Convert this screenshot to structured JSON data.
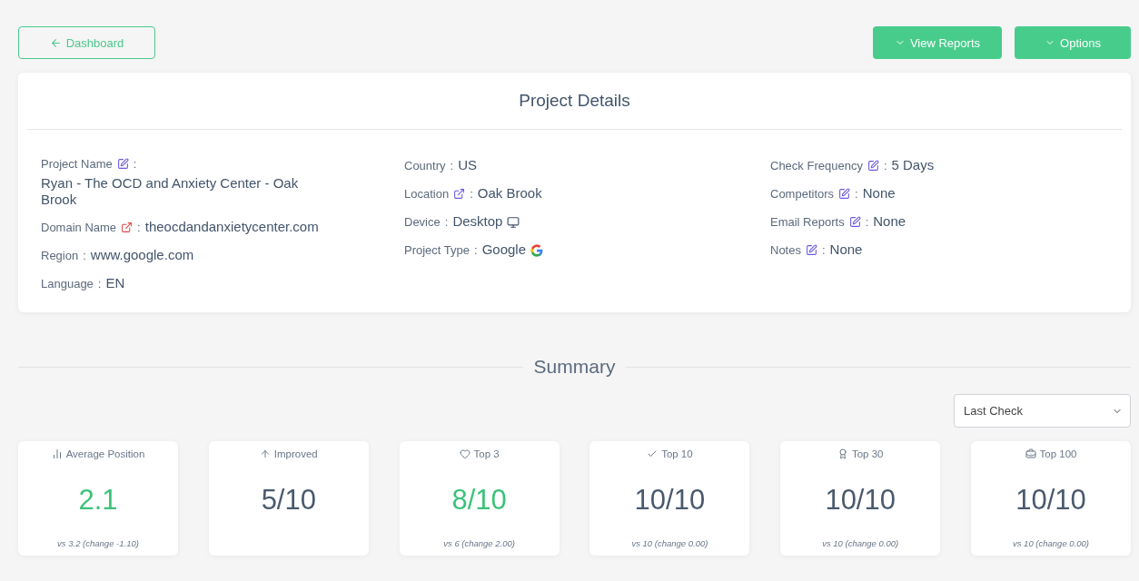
{
  "header": {
    "back_button": "Dashboard",
    "menu_buttons": [
      "View Reports",
      "Options"
    ]
  },
  "project_details": {
    "title": "Project Details",
    "columns": [
      [
        {
          "kind": "stacked_edit",
          "label": "Project Name",
          "colon": ":",
          "value": "Ryan - The OCD and Anxiety Center - Oak Brook"
        },
        {
          "kind": "link_alert",
          "label": "Domain Name",
          "colon": ":",
          "value": "theocdandanxietycenter.com"
        },
        {
          "kind": "plain",
          "label": "Region",
          "colon": ":",
          "value": "www.google.com"
        },
        {
          "kind": "plain",
          "label": "Language",
          "colon": ":",
          "value": "EN"
        }
      ],
      [
        {
          "kind": "plain",
          "label": "Country",
          "colon": ":",
          "value": "US"
        },
        {
          "kind": "link",
          "label": "Location",
          "colon": ":",
          "value": "Oak Brook"
        },
        {
          "kind": "device",
          "label": "Device",
          "colon": ":",
          "value": "Desktop"
        },
        {
          "kind": "search_engine",
          "label": "Project Type",
          "colon": ":",
          "value": "Google"
        }
      ],
      [
        {
          "kind": "edit",
          "label": "Check Frequency",
          "colon": ":",
          "value": "5 Days"
        },
        {
          "kind": "edit",
          "label": "Competitors",
          "colon": ":",
          "value": "None"
        },
        {
          "kind": "edit",
          "label": "Email Reports",
          "colon": ":",
          "value": "None"
        },
        {
          "kind": "edit",
          "label": "Notes",
          "colon": ":",
          "value": "None"
        }
      ]
    ]
  },
  "summary": {
    "title": "Summary",
    "period_select": "Last Check",
    "cards": [
      {
        "label": "Average Position",
        "value": "2.1",
        "highlighted": true,
        "comparison": "vs 3.2 (change -1.10)"
      },
      {
        "label": "Improved",
        "value": "5/10",
        "highlighted": false
      },
      {
        "label": "Top 3",
        "value": "8/10",
        "highlighted": true,
        "comparison": "vs 6 (change 2.00)"
      },
      {
        "label": "Top 10",
        "value": "10/10",
        "highlighted": false,
        "comparison": "vs 10 (change 0.00)"
      },
      {
        "label": "Top 30",
        "value": "10/10",
        "highlighted": false,
        "comparison": "vs 10 (change 0.00)"
      },
      {
        "label": "Top 100",
        "value": "10/10",
        "highlighted": false,
        "comparison": "vs 10 (change 0.00)"
      }
    ]
  }
}
